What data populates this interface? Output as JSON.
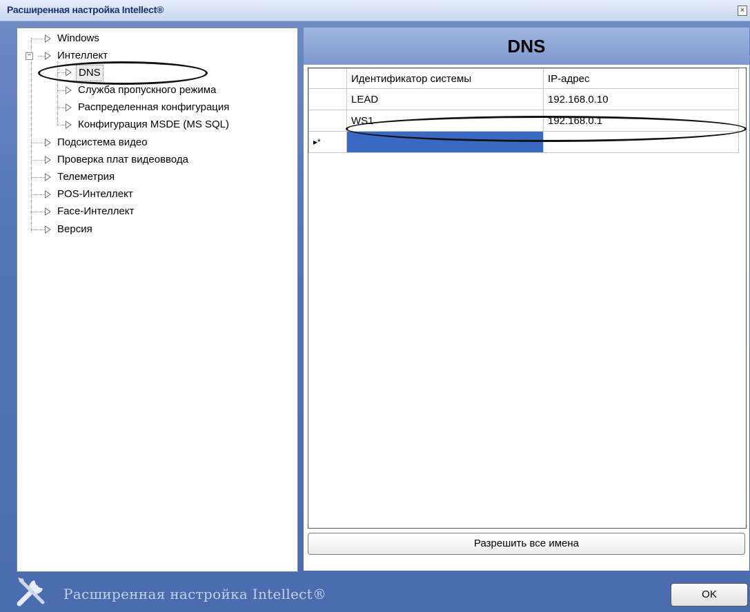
{
  "window": {
    "title": "Расширенная настройка Intellect®",
    "close_glyph": "×"
  },
  "tree": {
    "items": [
      {
        "label": "Windows"
      },
      {
        "label": "Интеллект"
      },
      {
        "label": "DNS"
      },
      {
        "label": "Служба пропускного режима"
      },
      {
        "label": "Распределенная конфигурация"
      },
      {
        "label": "Конфигурация MSDE (MS SQL)"
      },
      {
        "label": "Подсистема видео"
      },
      {
        "label": "Проверка плат видеоввода"
      },
      {
        "label": "Телеметрия"
      },
      {
        "label": "POS-Интеллект"
      },
      {
        "label": "Face-Интеллект"
      },
      {
        "label": "Версия"
      }
    ],
    "expander_glyph": "−"
  },
  "panel": {
    "title": "DNS",
    "columns": [
      "Идентификатор системы",
      "IP-адрес"
    ],
    "rows": [
      {
        "id": "LEAD",
        "ip": "192.168.0.10"
      },
      {
        "id": "WS1",
        "ip": "192.168.0.1"
      }
    ],
    "new_row_marker": "▸*",
    "resolve_button": "Разрешить все имена"
  },
  "footer": {
    "brand": "Расширенная настройка Intellect®",
    "ok_label": "OK"
  },
  "colors": {
    "selection": "#3a69c4",
    "header": "#7e99cf"
  }
}
